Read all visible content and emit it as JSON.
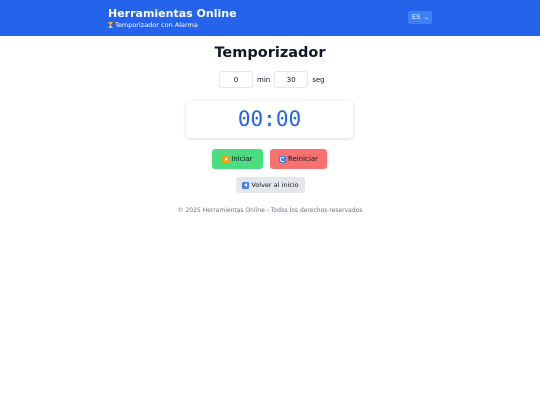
{
  "header": {
    "title": "Herramientas Online",
    "subtitle": "Temporizador con Alarma",
    "subtitle_icon": "hourglass-icon",
    "language": "ES"
  },
  "colors": {
    "header_bg": "#2563eb",
    "timer_text": "#2563eb",
    "start_button": "#4ade80",
    "reset_button": "#f87171",
    "back_button": "#e5e7eb"
  },
  "timer": {
    "title": "Temporizador",
    "minutes_value": "0",
    "minutes_unit": "min",
    "seconds_value": "30",
    "seconds_unit": "seg",
    "display": "00:00"
  },
  "buttons": {
    "start_label": "Iniciar",
    "start_icon": "play-icon",
    "reset_label": "Reiniciar",
    "reset_icon": "reload-icon",
    "back_label": "Volver al inicio",
    "back_icon": "back-arrow-icon"
  },
  "footer": {
    "text": "© 2025 Herramientas Online - Todos los derechos reservados"
  }
}
